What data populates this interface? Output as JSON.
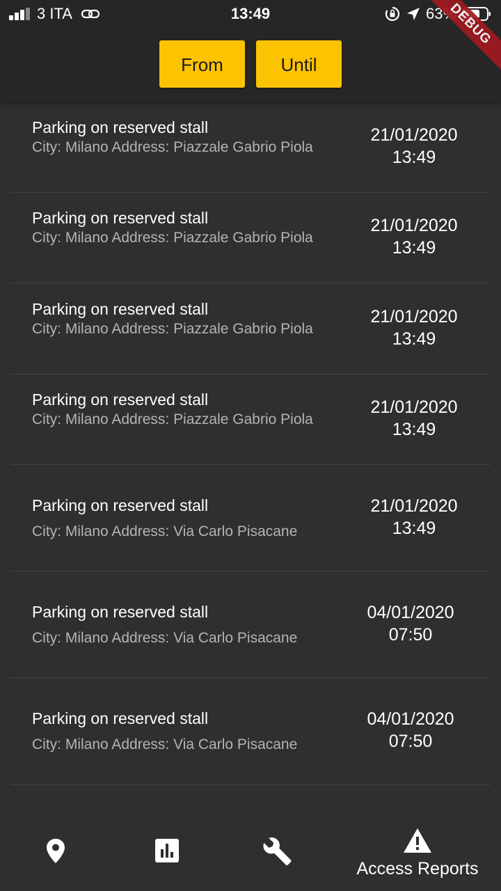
{
  "status_bar": {
    "carrier": "3 ITA",
    "time": "13:49",
    "battery": "63%"
  },
  "debug_banner": "DEBUG",
  "filters": {
    "from_label": "From",
    "until_label": "Until",
    "accent_color": "#fcc303"
  },
  "reports": [
    {
      "title": "Parking on reserved stall",
      "detail": "City: Milano Address: Piazzale Gabrio Piola",
      "date": "21/01/2020",
      "time": "13:49"
    },
    {
      "title": "Parking on reserved stall",
      "detail": "City: Milano Address: Piazzale Gabrio Piola",
      "date": "21/01/2020",
      "time": "13:49"
    },
    {
      "title": "Parking on reserved stall",
      "detail": "City: Milano Address: Piazzale Gabrio Piola",
      "date": "21/01/2020",
      "time": "13:49"
    },
    {
      "title": "Parking on reserved stall",
      "detail": "City: Milano Address: Piazzale Gabrio Piola",
      "date": "21/01/2020",
      "time": "13:49"
    },
    {
      "title": "Parking on reserved stall",
      "detail": "City: Milano Address: Via Carlo Pisacane",
      "date": "21/01/2020",
      "time": "13:49"
    },
    {
      "title": "Parking on reserved stall",
      "detail": "City: Milano Address: Via Carlo Pisacane",
      "date": "04/01/2020",
      "time": "07:50"
    },
    {
      "title": "Parking on reserved stall",
      "detail": "City: Milano Address: Via Carlo Pisacane",
      "date": "04/01/2020",
      "time": "07:50"
    }
  ],
  "bottom_nav": [
    {
      "icon": "map-pin-icon",
      "label": ""
    },
    {
      "icon": "bar-chart-icon",
      "label": ""
    },
    {
      "icon": "wrench-icon",
      "label": ""
    },
    {
      "icon": "warning-icon",
      "label": "Access Reports",
      "active": true
    }
  ]
}
